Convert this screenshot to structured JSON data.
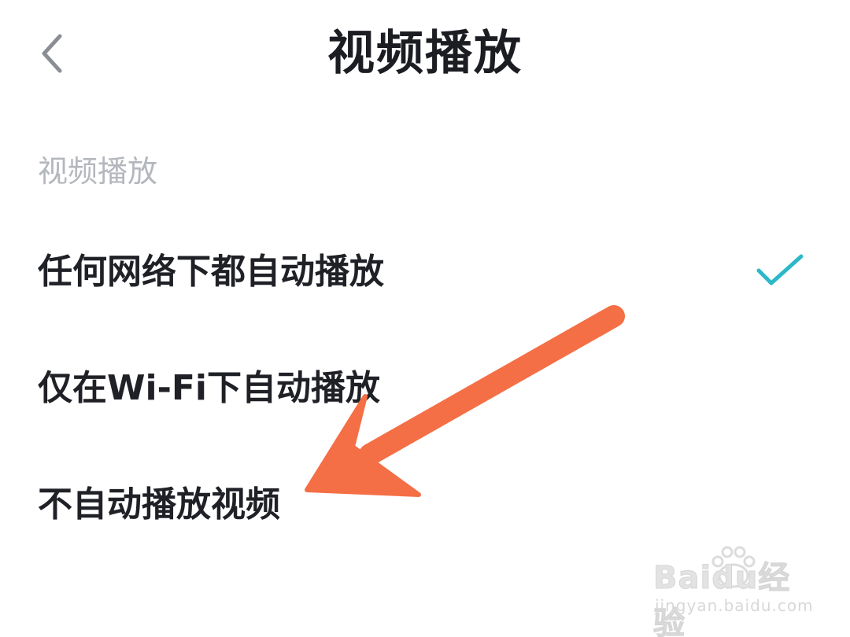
{
  "header": {
    "back_icon": "chevron-left-icon",
    "title": "视频播放"
  },
  "section": {
    "label": "视频播放"
  },
  "options": [
    {
      "label": "任何网络下都自动播放",
      "selected": true
    },
    {
      "label": "仅在Wi-Fi下自动播放",
      "selected": false
    },
    {
      "label": "不自动播放视频",
      "selected": false
    }
  ],
  "selected_icon": "checkmark-icon",
  "colors": {
    "accent": "#2bb8c8",
    "title_text": "#1b1d22",
    "option_text": "#1f2126",
    "section_label": "#b4b7bd",
    "annotation_arrow": "#f46f45"
  },
  "watermark": {
    "brand": "Baidu经验",
    "url": "jingyan.baidu.com"
  }
}
